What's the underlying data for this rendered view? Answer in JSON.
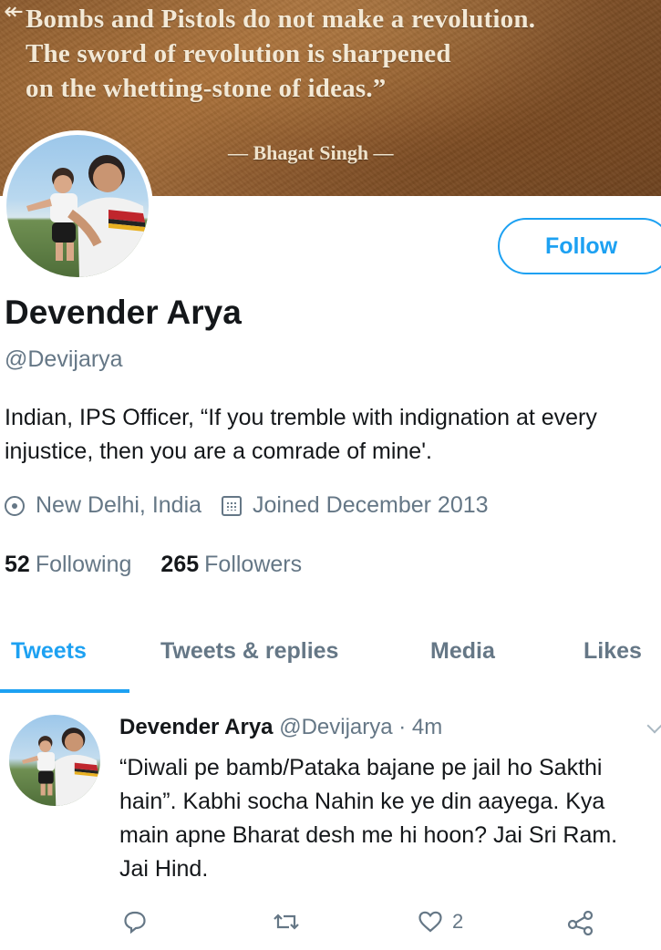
{
  "header": {
    "back_arrow": "↞",
    "quote_lines": [
      "Bombs and Pistols do not make a revolution.",
      "The sword of revolution is sharpened",
      "on the whetting-stone of ideas.”"
    ],
    "quote_author": "— Bhagat Singh —",
    "banner_color": "#8a5a2e"
  },
  "profile": {
    "follow_label": "Follow",
    "name": "Devender Arya",
    "handle": "@Devijarya",
    "bio": "Indian, IPS Officer, “If you tremble with indignation at every injustice, then you are a comrade of mine'.",
    "location": "New Delhi, India",
    "joined": "Joined December 2013",
    "following_count": "52",
    "following_label": "Following",
    "followers_count": "265",
    "followers_label": "Followers",
    "accent_color": "#1da1f2"
  },
  "tabs": [
    {
      "label": "Tweets",
      "active": true
    },
    {
      "label": "Tweets & replies",
      "active": false
    },
    {
      "label": "Media",
      "active": false
    },
    {
      "label": "Likes",
      "active": false
    }
  ],
  "tweet": {
    "name": "Devender Arya",
    "handle_time": "@Devijarya · 4m",
    "text": "“Diwali pe bamb/Pataka bajane pe jail ho Sakthi hain”. Kabhi socha Nahin ke ye din aayega. Kya main apne Bharat desh me hi hoon? Jai Sri Ram. Jai Hind.",
    "like_count": "2",
    "icons": [
      "reply-icon",
      "retweet-icon",
      "like-icon",
      "share-icon"
    ]
  }
}
